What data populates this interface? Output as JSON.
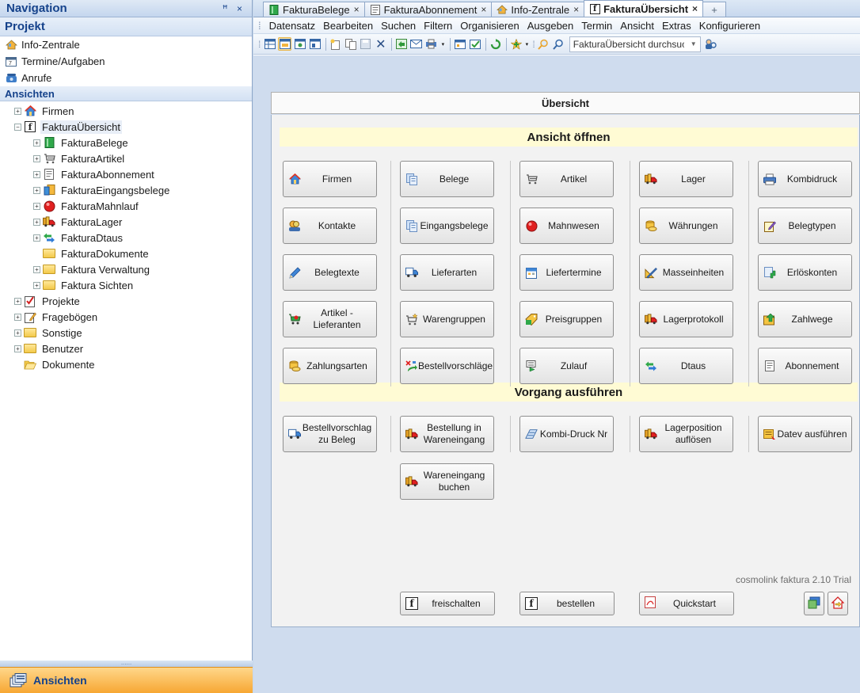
{
  "nav": {
    "title": "Navigation",
    "pin": "ꟸ",
    "close": "×",
    "project_header": "Projekt",
    "project_links": [
      {
        "label": "Info-Zentrale",
        "icon": "home-icon"
      },
      {
        "label": "Termine/Aufgaben",
        "icon": "calendar-icon"
      },
      {
        "label": "Anrufe",
        "icon": "phone-icon"
      }
    ],
    "views_header": "Ansichten",
    "tree": [
      {
        "label": "Firmen",
        "level": 0,
        "expander": "+",
        "icon": "house-icon"
      },
      {
        "label": "FakturaÜbersicht",
        "level": 0,
        "expander": "−",
        "icon": "faktura-icon",
        "selected": true
      },
      {
        "label": "FakturaBelege",
        "level": 1,
        "expander": "+",
        "icon": "book-icon"
      },
      {
        "label": "FakturaArtikel",
        "level": 1,
        "expander": "+",
        "icon": "cart-icon"
      },
      {
        "label": "FakturaAbonnement",
        "level": 1,
        "expander": "+",
        "icon": "document-icon"
      },
      {
        "label": "FakturaEingangsbelege",
        "level": 1,
        "expander": "+",
        "icon": "incoming-docs-icon"
      },
      {
        "label": "FakturaMahnlauf",
        "level": 1,
        "expander": "+",
        "icon": "red-dot-icon"
      },
      {
        "label": "FakturaLager",
        "level": 1,
        "expander": "+",
        "icon": "truck-icon"
      },
      {
        "label": "FakturaDtaus",
        "level": 1,
        "expander": "+",
        "icon": "transfer-icon"
      },
      {
        "label": "FakturaDokumente",
        "level": 1,
        "expander": "",
        "icon": "folder-icon"
      },
      {
        "label": "Faktura Verwaltung",
        "level": 1,
        "expander": "+",
        "icon": "folder-icon"
      },
      {
        "label": "Faktura Sichten",
        "level": 1,
        "expander": "+",
        "icon": "folder-icon"
      },
      {
        "label": "Projekte",
        "level": 0,
        "expander": "+",
        "icon": "checklist-icon"
      },
      {
        "label": "Fragebögen",
        "level": 0,
        "expander": "+",
        "icon": "form-icon"
      },
      {
        "label": "Sonstige",
        "level": 0,
        "expander": "+",
        "icon": "folder-icon"
      },
      {
        "label": "Benutzer",
        "level": 0,
        "expander": "+",
        "icon": "folder-icon"
      },
      {
        "label": "Dokumente",
        "level": 0,
        "expander": "",
        "icon": "open-folder-icon"
      }
    ],
    "splitter_dots": "......",
    "footer_label": "Ansichten"
  },
  "tabs": [
    {
      "label": "FakturaBelege",
      "icon": "book-icon",
      "close": "×",
      "active": false
    },
    {
      "label": "FakturaAbonnement",
      "icon": "document-icon",
      "close": "×",
      "active": false
    },
    {
      "label": "Info-Zentrale",
      "icon": "home-icon",
      "close": "×",
      "active": false
    },
    {
      "label": "FakturaÜbersicht",
      "icon": "faktura-icon",
      "close": "×",
      "active": true
    }
  ],
  "tab_add": "+",
  "menu": [
    "Datensatz",
    "Bearbeiten",
    "Suchen",
    "Filtern",
    "Organisieren",
    "Ausgeben",
    "Termin",
    "Ansicht",
    "Extras",
    "Konfigurieren"
  ],
  "search": {
    "value": "FakturaÜbersicht durchsuc",
    "placeholder": "FakturaÜbersicht durchsuchen"
  },
  "panel": {
    "title": "Übersicht",
    "open_view_header": "Ansicht öffnen",
    "run_action_header": "Vorgang ausführen",
    "open_view_buttons": [
      {
        "label": "Firmen",
        "icon": "house-icon"
      },
      {
        "label": "Belege",
        "icon": "documents-icon"
      },
      {
        "label": "Artikel",
        "icon": "cart-icon"
      },
      {
        "label": "Lager",
        "icon": "truck-icon"
      },
      {
        "label": "Kombidruck",
        "icon": "printer-icon"
      },
      {
        "label": "Kontakte",
        "icon": "contacts-icon"
      },
      {
        "label": "Eingangsbelege",
        "icon": "documents-icon"
      },
      {
        "label": "Mahnwesen",
        "icon": "red-dot-icon"
      },
      {
        "label": "Währungen",
        "icon": "coins-icon"
      },
      {
        "label": "Belegtypen",
        "icon": "notepad-icon"
      },
      {
        "label": "Belegtexte",
        "icon": "pencil-icon"
      },
      {
        "label": "Lieferarten",
        "icon": "delivery-icon"
      },
      {
        "label": "Liefertermine",
        "icon": "calendar-icon"
      },
      {
        "label": "Masseinheiten",
        "icon": "ruler-icon"
      },
      {
        "label": "Erlöskonten",
        "icon": "account-icon"
      },
      {
        "label": "Artikel -\nLieferanten",
        "icon": "supplier-icon"
      },
      {
        "label": "Warengruppen",
        "icon": "cart-star-icon"
      },
      {
        "label": "Preisgruppen",
        "icon": "price-icon"
      },
      {
        "label": "Lagerprotokoll",
        "icon": "truck-icon"
      },
      {
        "label": "Zahlwege",
        "icon": "payment-icon"
      },
      {
        "label": "Zahlungsarten",
        "icon": "coins-icon"
      },
      {
        "label": "Bestellvorschläge",
        "icon": "order-suggest-icon"
      },
      {
        "label": "Zulauf",
        "icon": "cart-in-icon"
      },
      {
        "label": "Dtaus",
        "icon": "transfer-icon"
      },
      {
        "label": "Abonnement",
        "icon": "document-icon"
      }
    ],
    "action_buttons": [
      {
        "label": "Bestellvorschlag\nzu Beleg",
        "icon": "delivery-icon"
      },
      {
        "label": "Bestellung in\nWareneingang",
        "icon": "truck-icon"
      },
      {
        "label": "Kombi-Druck Nr",
        "icon": "kombi-print-icon"
      },
      {
        "label": "Lagerposition\nauflösen",
        "icon": "truck-icon"
      },
      {
        "label": "Datev ausführen",
        "icon": "datev-icon"
      },
      {
        "label": "Wareneingang\nbuchen",
        "icon": "truck-icon"
      }
    ],
    "version": "cosmolink faktura 2.10 Trial",
    "bottom_buttons": [
      {
        "label": "freischalten",
        "icon": "faktura-icon"
      },
      {
        "label": "bestellen",
        "icon": "faktura-icon"
      },
      {
        "label": "Quickstart",
        "icon": "pdf-icon"
      }
    ]
  },
  "colors": {
    "nav_title": "#15428b",
    "section_head_bg": "#fffbd4",
    "footer_bg": "#f7a733",
    "accent_red": "#e02020"
  }
}
